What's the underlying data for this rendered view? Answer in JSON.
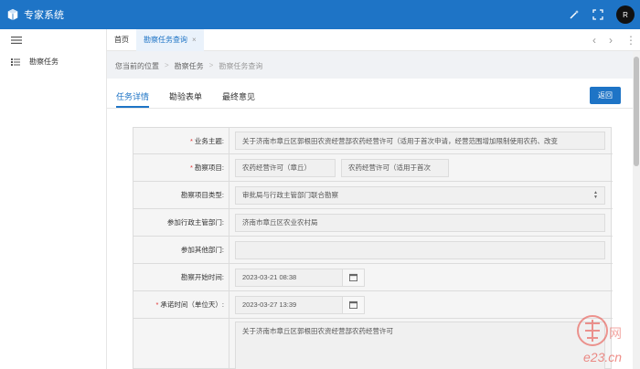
{
  "app": {
    "title": "专家系统",
    "avatar_letter": "R"
  },
  "sidebar": {
    "items": [
      {
        "label": "勘察任务",
        "icon": "list-icon"
      }
    ]
  },
  "tabs": [
    {
      "label": "首页",
      "active": false
    },
    {
      "label": "勘察任务查询",
      "active": true,
      "close": "×"
    }
  ],
  "tab_nav": {
    "prev": "‹",
    "next": "›",
    "more": "⋮"
  },
  "breadcrumb": {
    "items": [
      "您当前的位置",
      "勘察任务",
      "勘察任务查询"
    ],
    "separator": ">"
  },
  "content_tabs": [
    {
      "label": "任务详情",
      "active": true
    },
    {
      "label": "勘验表单",
      "active": false
    },
    {
      "label": "最终意见",
      "active": false
    }
  ],
  "back_button": "返回",
  "form": {
    "business_subject": {
      "label": "业务主题:",
      "required": true,
      "value": "关于济南市章丘区郭根田农资经营部农药经营许可（适用于首次申请，经营范围增加限制使用农药、改变"
    },
    "survey_items": {
      "label": "勘察项目:",
      "required": true,
      "values": [
        "农药经营许可（章丘）",
        "农药经营许可（适用于首次"
      ]
    },
    "survey_type": {
      "label": "勘察项目类型:",
      "required": false,
      "value": "审批局与行政主管部门联合勘察"
    },
    "admin_dept": {
      "label": "参加行政主管部门:",
      "required": false,
      "value": "济南市章丘区农业农村局"
    },
    "other_dept": {
      "label": "参加其他部门:",
      "required": false,
      "value": ""
    },
    "start_time": {
      "label": "勘察开始时间:",
      "required": false,
      "value": "2023-03-21 08:38"
    },
    "promise_time": {
      "label": "承诺时间（单位天）:",
      "required": true,
      "value": "2023-03-27 13:39"
    },
    "description": {
      "label": "",
      "value": "关于济南市章丘区郭根田农资经营部农药经营许可"
    }
  },
  "watermark": {
    "text": "e23.cn"
  },
  "colors": {
    "primary": "#1e74c6",
    "required": "#e03131"
  }
}
